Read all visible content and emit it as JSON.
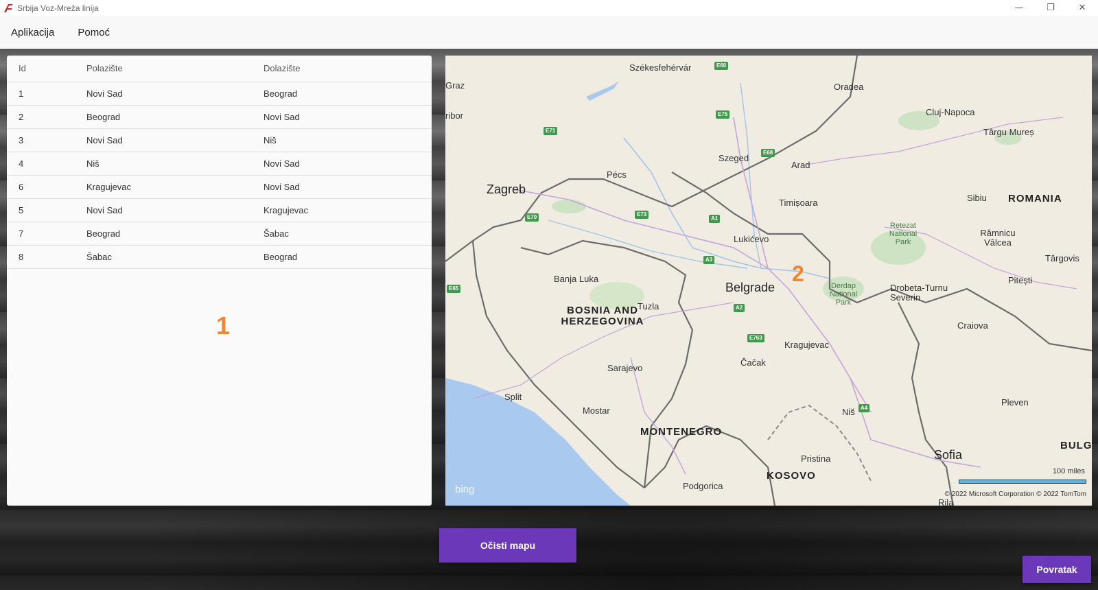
{
  "window": {
    "title": "Srbija Voz-Mreža linija",
    "minimize_glyph": "—",
    "maximize_glyph": "❐",
    "close_glyph": "✕"
  },
  "menu": {
    "items": [
      {
        "label": "Aplikacija"
      },
      {
        "label": "Pomoć"
      }
    ]
  },
  "table": {
    "headers": {
      "id": "Id",
      "from": "Polazište",
      "to": "Dolazište"
    },
    "rows": [
      {
        "id": "1",
        "from": "Novi Sad",
        "to": "Beograd"
      },
      {
        "id": "2",
        "from": "Beograd",
        "to": "Novi Sad"
      },
      {
        "id": "3",
        "from": "Novi Sad",
        "to": "Niš"
      },
      {
        "id": "4",
        "from": "Niš",
        "to": "Novi Sad"
      },
      {
        "id": "6",
        "from": "Kragujevac",
        "to": "Novi Sad"
      },
      {
        "id": "5",
        "from": "Novi Sad",
        "to": "Kragujevac"
      },
      {
        "id": "7",
        "from": "Beograd",
        "to": "Šabac"
      },
      {
        "id": "8",
        "from": "Šabac",
        "to": "Beograd"
      }
    ]
  },
  "annotations": {
    "marker_1": "1",
    "marker_2": "2",
    "color": "#f0862e"
  },
  "map": {
    "cities": [
      {
        "name": "Székesfehérvár"
      },
      {
        "name": "Oradea"
      },
      {
        "name": "Graz"
      },
      {
        "name": "Cluj-Napoca"
      },
      {
        "name": "ribor"
      },
      {
        "name": "Târgu Mureș"
      },
      {
        "name": "Szeged"
      },
      {
        "name": "Arad"
      },
      {
        "name": "Pécs"
      },
      {
        "name": "Zagreb"
      },
      {
        "name": "Timișoara"
      },
      {
        "name": "Sibiu"
      },
      {
        "name": "Lukićevo"
      },
      {
        "name": "Râmnicu Vâlcea"
      },
      {
        "name": "Târgovis"
      },
      {
        "name": "Banja Luka"
      },
      {
        "name": "Belgrade"
      },
      {
        "name": "Pitești"
      },
      {
        "name": "Drobeta-Turnu Severin"
      },
      {
        "name": "Tuzla"
      },
      {
        "name": "Craiova"
      },
      {
        "name": "Kragujevac"
      },
      {
        "name": "Čačak"
      },
      {
        "name": "Sarajevo"
      },
      {
        "name": "Split"
      },
      {
        "name": "Mostar"
      },
      {
        "name": "Niš"
      },
      {
        "name": "Pleven"
      },
      {
        "name": "Sofia"
      },
      {
        "name": "Pristina"
      },
      {
        "name": "Podgorica"
      },
      {
        "name": "Rila"
      }
    ],
    "countries": [
      {
        "name": "ROMANIA"
      },
      {
        "name": "BOSNIA AND HERZEGOVINA"
      },
      {
        "name": "MONTENEGRO"
      },
      {
        "name": "KOSOVO"
      },
      {
        "name": "BULGA"
      }
    ],
    "parks": [
      {
        "name": "Retezat National Park"
      },
      {
        "name": "Derdap National Park"
      }
    ],
    "roads": [
      "E60",
      "E75",
      "E71",
      "E68",
      "E73",
      "A1",
      "E70",
      "A3",
      "E65",
      "A2",
      "E763",
      "A4"
    ],
    "bing_text": "bing",
    "scale_label": "100 miles",
    "copyright": "© 2022 Microsoft Corporation   © 2022 TomTom"
  },
  "buttons": {
    "clear_map": "Očisti mapu",
    "back": "Povratak",
    "accent": "#6a38b8"
  }
}
